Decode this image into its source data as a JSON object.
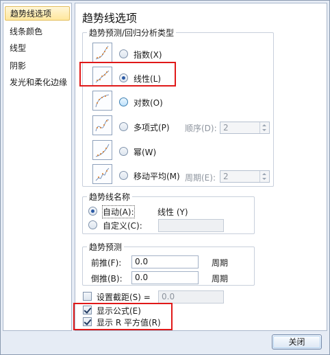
{
  "nav": {
    "items": [
      {
        "label": "趋势线选项"
      },
      {
        "label": "线条颜色"
      },
      {
        "label": "线型"
      },
      {
        "label": "阴影"
      },
      {
        "label": "发光和柔化边缘"
      }
    ]
  },
  "main": {
    "title": "趋势线选项",
    "type_group": {
      "title": "趋势预测/回归分析类型",
      "options": [
        {
          "label": "指数(X)"
        },
        {
          "label": "线性(L)"
        },
        {
          "label": "对数(O)"
        },
        {
          "label": "多项式(P)"
        },
        {
          "label": "幂(W)"
        },
        {
          "label": "移动平均(M)"
        }
      ],
      "order_label": "顺序(D):",
      "order_value": "2",
      "period_label": "周期(E):",
      "period_value": "2"
    },
    "name_group": {
      "title": "趋势线名称",
      "auto_label": "自动(A):",
      "auto_value": "线性 (Y)",
      "custom_label": "自定义(C):",
      "custom_value": ""
    },
    "forecast_group": {
      "title": "趋势预测",
      "forward_label": "前推(F):",
      "forward_value": "0.0",
      "forward_unit": "周期",
      "backward_label": "倒推(B):",
      "backward_value": "0.0",
      "backward_unit": "周期"
    },
    "intercept": {
      "label": "设置截距(S) =",
      "value": "0.0"
    },
    "show_equation": {
      "label": "显示公式(E)"
    },
    "show_r2": {
      "label": "显示 R 平方值(R)"
    }
  },
  "footer": {
    "close_label": "关闭"
  },
  "colors": {
    "highlight": "#e01818",
    "accent": "#2b5aa5"
  },
  "icons": [
    "exponential-trendline-icon",
    "linear-trendline-icon",
    "logarithmic-trendline-icon",
    "polynomial-trendline-icon",
    "power-trendline-icon",
    "moving-average-trendline-icon"
  ]
}
